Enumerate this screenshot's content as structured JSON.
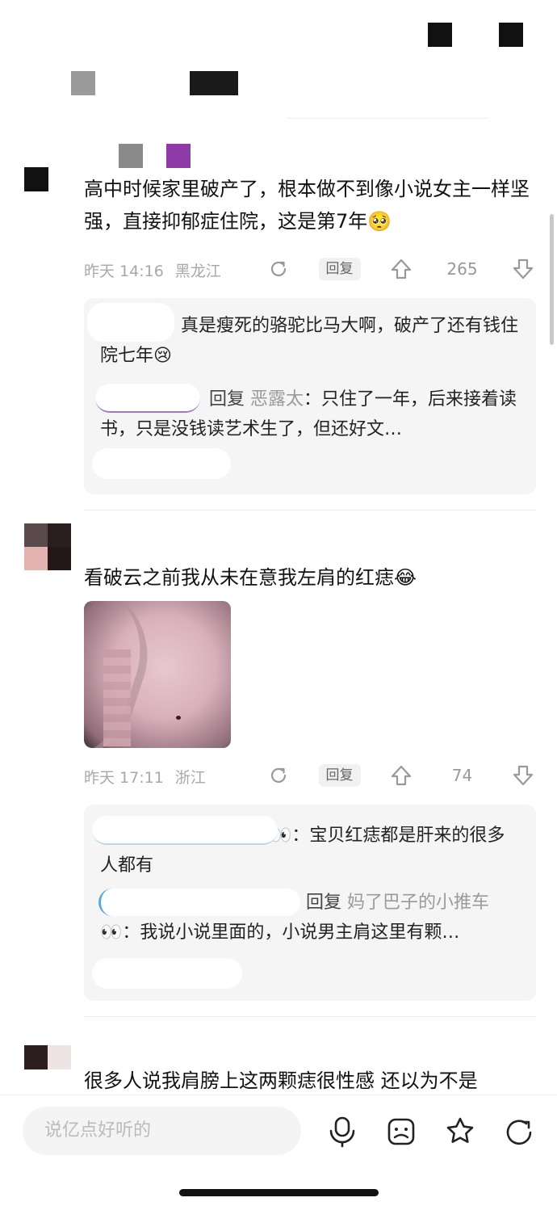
{
  "comments": [
    {
      "text": "高中时候家里破产了，根本做不到像小说女主一样坚强，直接抑郁症住院，这是第7年🥺",
      "time": "昨天 14:16",
      "location": "黑龙江",
      "reply_label": "回复",
      "likes": "265",
      "replies": [
        {
          "text": "真是瘦死的骆驼比马大啊，破产了还有钱住院七年😢"
        },
        {
          "reply_word": "回复",
          "target": "恶露太",
          "text": "：只住了一年，后来接着读书，只是没钱读艺术生了，但还好文…"
        }
      ]
    },
    {
      "text": "看破云之前我从未在意我左肩的红痣😂",
      "time": "昨天 17:11",
      "location": "浙江",
      "reply_label": "回复",
      "likes": "74",
      "replies": [
        {
          "prefix": "👀",
          "text": "：宝贝红痣都是肝来的很多人都有"
        },
        {
          "reply_word": "回复",
          "target": "妈了巴子的小推车👀",
          "text": "：我说小说里面的，小说男主肩这里有颗…"
        }
      ]
    },
    {
      "text": "很多人说我肩膀上这两颗痣很性感 还以为不是"
    }
  ],
  "bottom_bar": {
    "input_placeholder": "说亿点好听的",
    "icons": [
      "microphone-icon",
      "sticker-icon",
      "star-icon",
      "share-icon"
    ]
  },
  "colors": {
    "meta_text": "#a8a8a8",
    "reply_box_bg": "#f5f5f5",
    "link_blue": "#5aa7e0"
  }
}
